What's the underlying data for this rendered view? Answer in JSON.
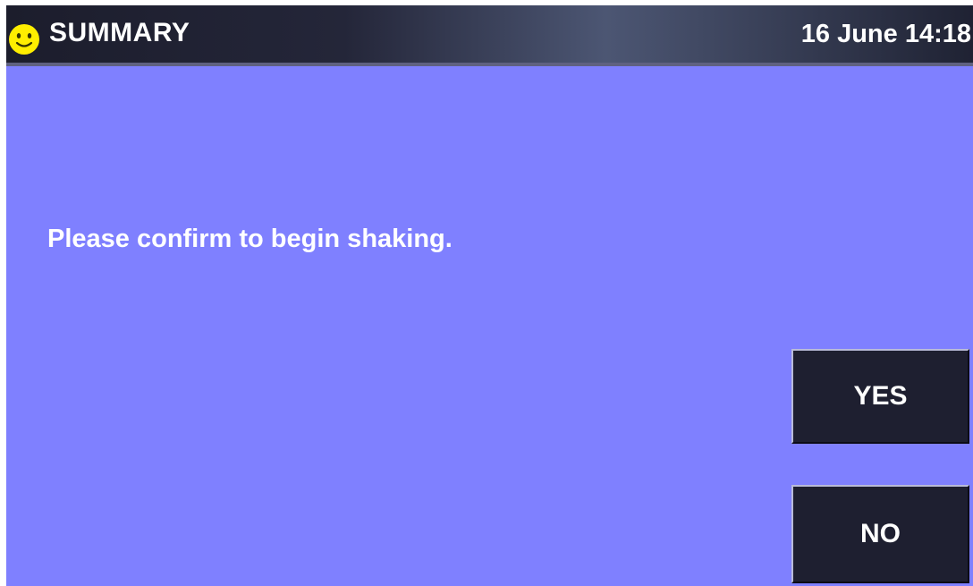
{
  "header": {
    "icon": "smiley-icon",
    "title": "SUMMARY",
    "datetime": "16 June 14:18"
  },
  "main": {
    "message": "Please confirm to begin shaking."
  },
  "buttons": {
    "yes_label": "YES",
    "no_label": "NO"
  },
  "colors": {
    "background": "#7f80ff",
    "header_bg": "#1c1d2c",
    "button_bg": "#1e1f30",
    "icon_yellow": "#ffee00",
    "text": "#ffffff"
  }
}
